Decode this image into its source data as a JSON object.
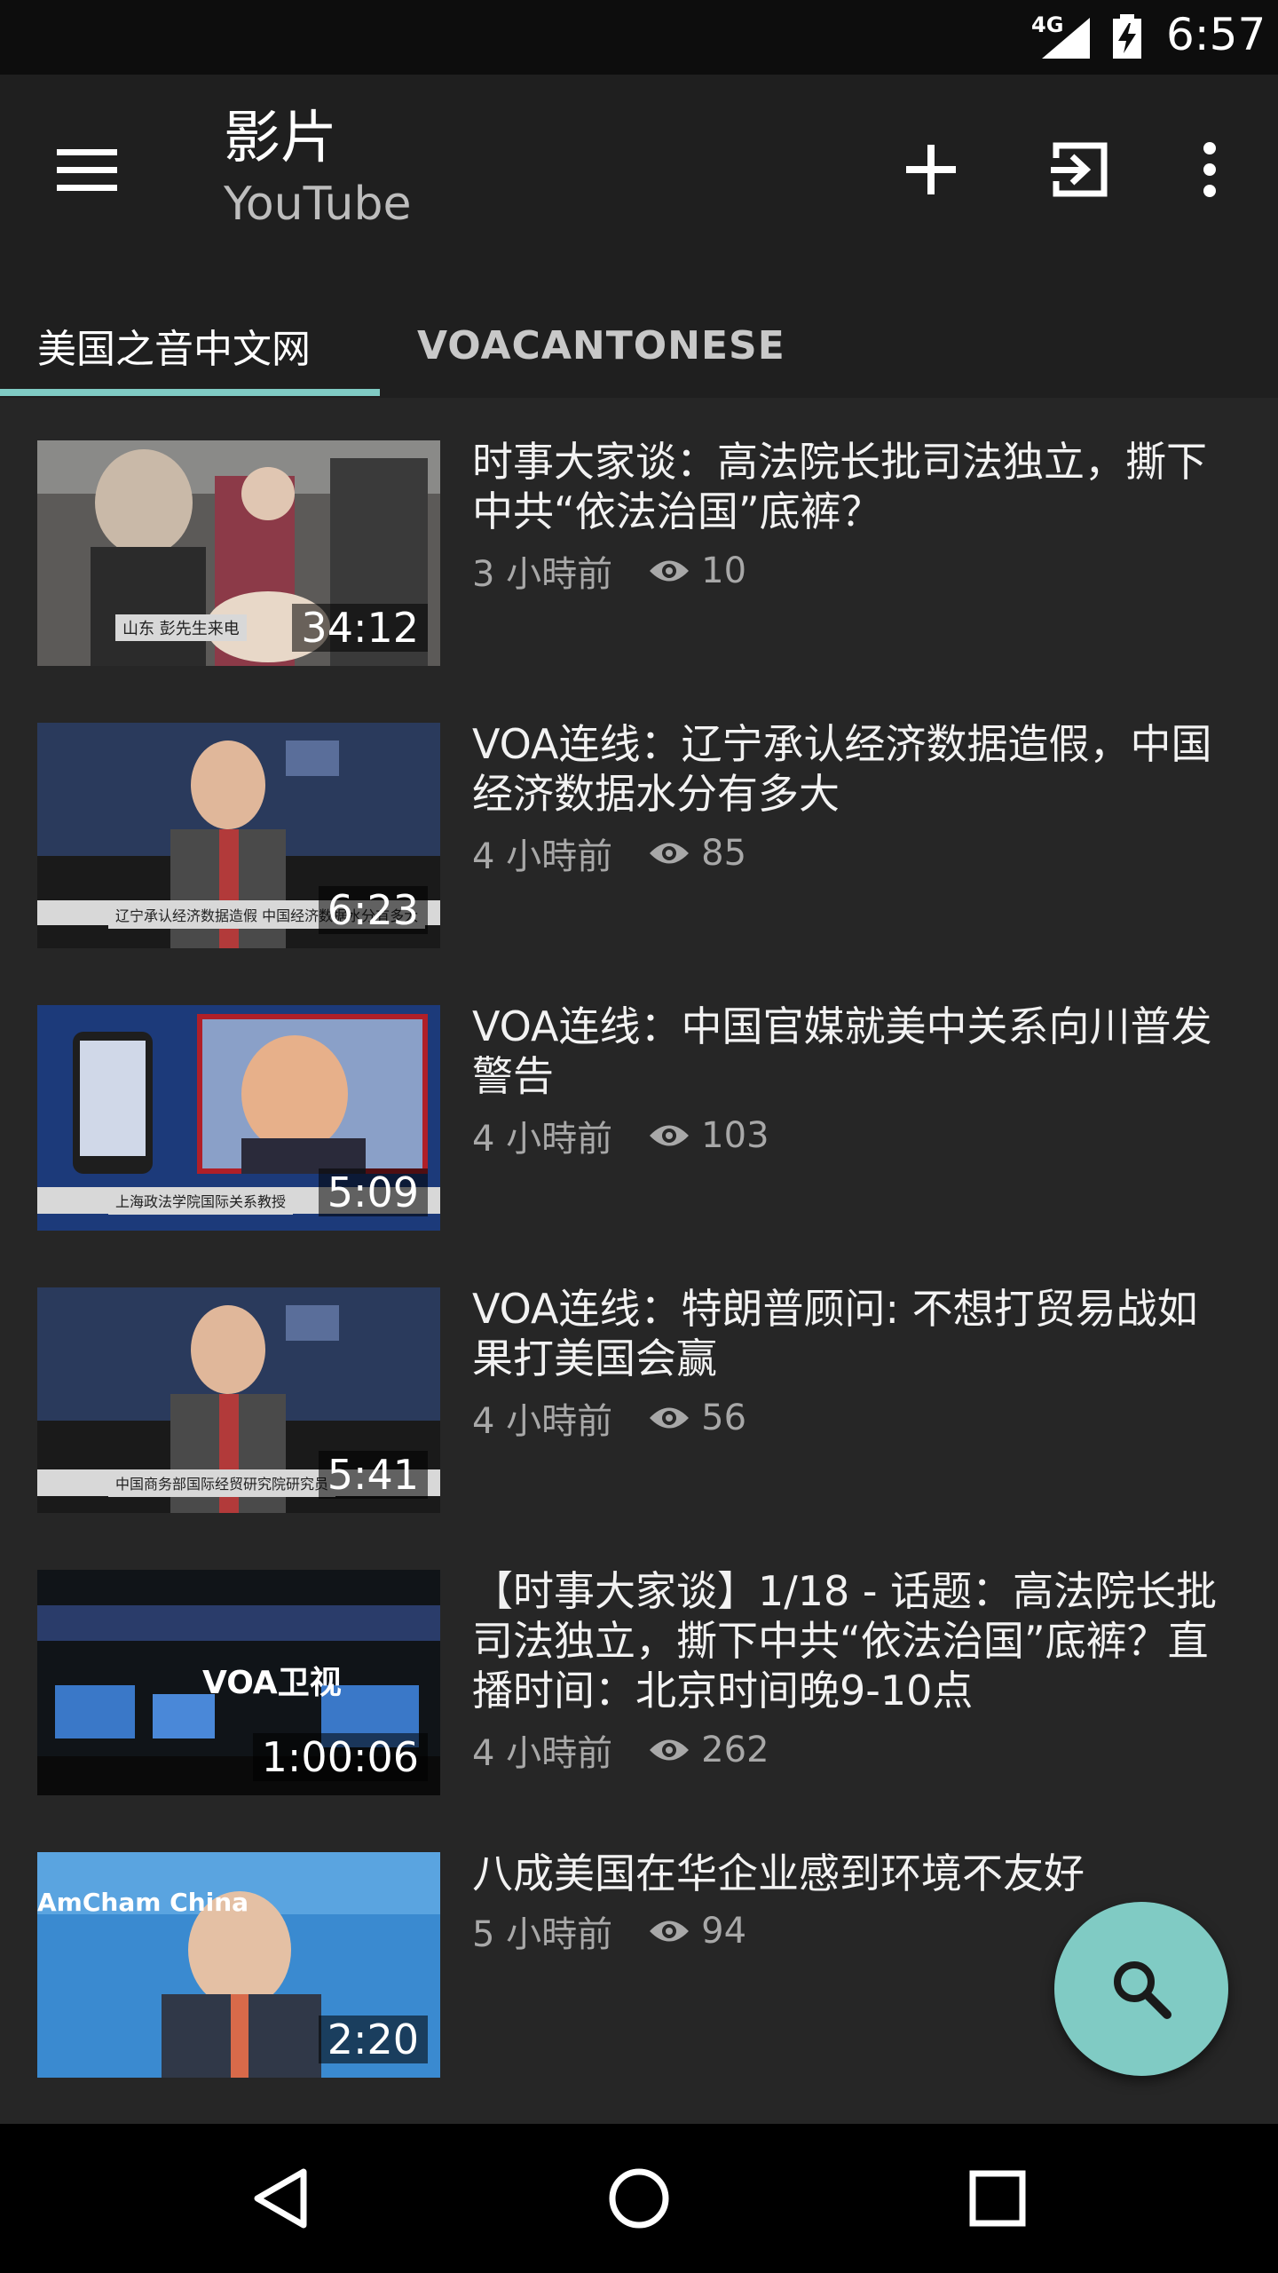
{
  "status_bar": {
    "network": "4G",
    "time": "6:57"
  },
  "app_bar": {
    "title": "影片",
    "subtitle": "YouTube",
    "icons": {
      "menu": "menu-icon",
      "add": "add-icon",
      "exit": "exit-icon",
      "more": "more-vert-icon"
    }
  },
  "tabs": [
    {
      "label": "美国之音中文网",
      "active": true
    },
    {
      "label": "VOACANTONESE",
      "active": false
    }
  ],
  "videos": [
    {
      "title": "时事大家谈：高法院长批司法独立，撕下中共“依法治国”底裤？",
      "duration": "34:12",
      "age": "3 小時前",
      "views": "10",
      "thumb_caption": "山东 彭先生来电"
    },
    {
      "title": "VOA连线：辽宁承认经济数据造假，中国经济数据水分有多大",
      "duration": "6:23",
      "age": "4 小時前",
      "views": "85",
      "thumb_caption": "辽宁承认经济数据造假 中国经济数据水分有多大"
    },
    {
      "title": "VOA连线：中国官媒就美中关系向川普发警告",
      "duration": "5:09",
      "age": "4 小時前",
      "views": "103",
      "thumb_caption": "上海政法学院国际关系教授"
    },
    {
      "title": "VOA连线：特朗普顾问: 不想打贸易战如果打美国会赢",
      "duration": "5:41",
      "age": "4 小時前",
      "views": "56",
      "thumb_caption": "中国商务部国际经贸研究院研究员"
    },
    {
      "title": "【时事大家谈】1/18 - 话题：高法院长批司法独立，撕下中共“依法治国”底裤？直播时间：北京时间晚9-10点",
      "duration": "1:00:06",
      "age": "4 小時前",
      "views": "262",
      "thumb_caption": "VOA卫视"
    },
    {
      "title": "八成美国在华企业感到环境不友好",
      "duration": "2:20",
      "age": "5 小時前",
      "views": "94",
      "thumb_caption": "AmCham China"
    }
  ],
  "fab": {
    "icon": "search-icon"
  },
  "nav": {
    "back": "back-icon",
    "home": "home-icon",
    "recents": "recents-icon"
  },
  "colors": {
    "accent": "#80cbc4",
    "app_bar": "#1f1f1f",
    "background": "#262626"
  }
}
